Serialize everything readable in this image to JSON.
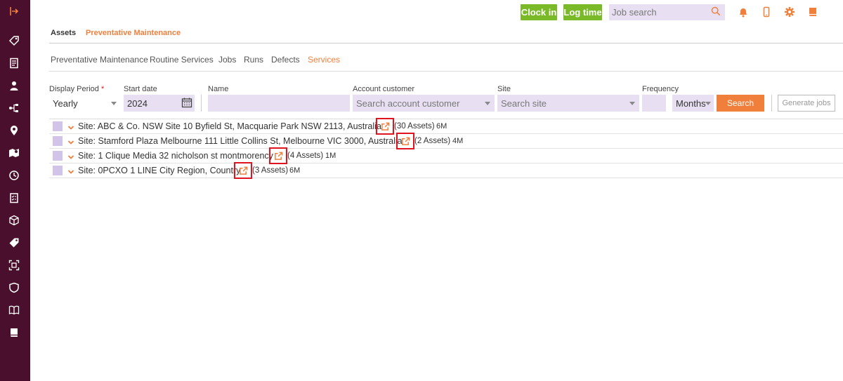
{
  "sidebar": {
    "icons": [
      "collapse-arrow-icon",
      "tag-location-icon",
      "document-icon",
      "person-icon",
      "hierarchy-icon",
      "map-pin-icon",
      "map-marker-icon",
      "clock-icon",
      "checklist-icon",
      "cube-icon",
      "price-tag-icon",
      "scan-icon",
      "shield-icon",
      "book-icon",
      "book-closed-icon"
    ]
  },
  "topbar": {
    "clock_in": "Clock in",
    "log_time": "Log time",
    "job_search_placeholder": "Job search"
  },
  "main_tabs": [
    {
      "label": "Assets",
      "active": false
    },
    {
      "label": "Preventative Maintenance",
      "active": true
    }
  ],
  "sub_tabs": [
    {
      "label": "Preventative Maintenance",
      "active": false
    },
    {
      "label": "Routine Services",
      "active": false
    },
    {
      "label": "Jobs",
      "active": false
    },
    {
      "label": "Runs",
      "active": false
    },
    {
      "label": "Defects",
      "active": false
    },
    {
      "label": "Services",
      "active": true
    }
  ],
  "filters": {
    "display_period_label": "Display Period",
    "required_mark": "*",
    "display_period_value": "Yearly",
    "start_date_label": "Start date",
    "start_date_value": "2024",
    "name_label": "Name",
    "name_value": "",
    "account_customer_label": "Account customer",
    "account_customer_placeholder": "Search account customer",
    "site_label": "Site",
    "site_placeholder": "Search site",
    "frequency_label": "Frequency",
    "frequency_value": "",
    "frequency_unit": "Months",
    "search_button": "Search",
    "generate_jobs_button": "Generate jobs"
  },
  "rows": [
    {
      "site": "Site: ABC & Co. NSW Site 10 Byfield St, Macquarie Park NSW 2113, Australia",
      "assets": "(30 Assets)",
      "freq": "6M"
    },
    {
      "site": "Site: Stamford Plaza Melbourne 111 Little Collins St, Melbourne VIC 3000, Australia",
      "assets": "(2 Assets)",
      "freq": "4M"
    },
    {
      "site": "Site: 1 Clique Media 32 nicholson st montmorency",
      "assets": "(4 Assets)",
      "freq": "1M"
    },
    {
      "site": "Site: 0PCXO 1 LINE City Region, Country",
      "assets": "(3 Assets)",
      "freq": "6M"
    }
  ],
  "colors": {
    "sidebar_bg": "#4a0f2c",
    "accent_orange": "#f07f3c",
    "green": "#7ab928",
    "input_bg": "#e8e0f2",
    "highlight_red": "#e0141e"
  }
}
